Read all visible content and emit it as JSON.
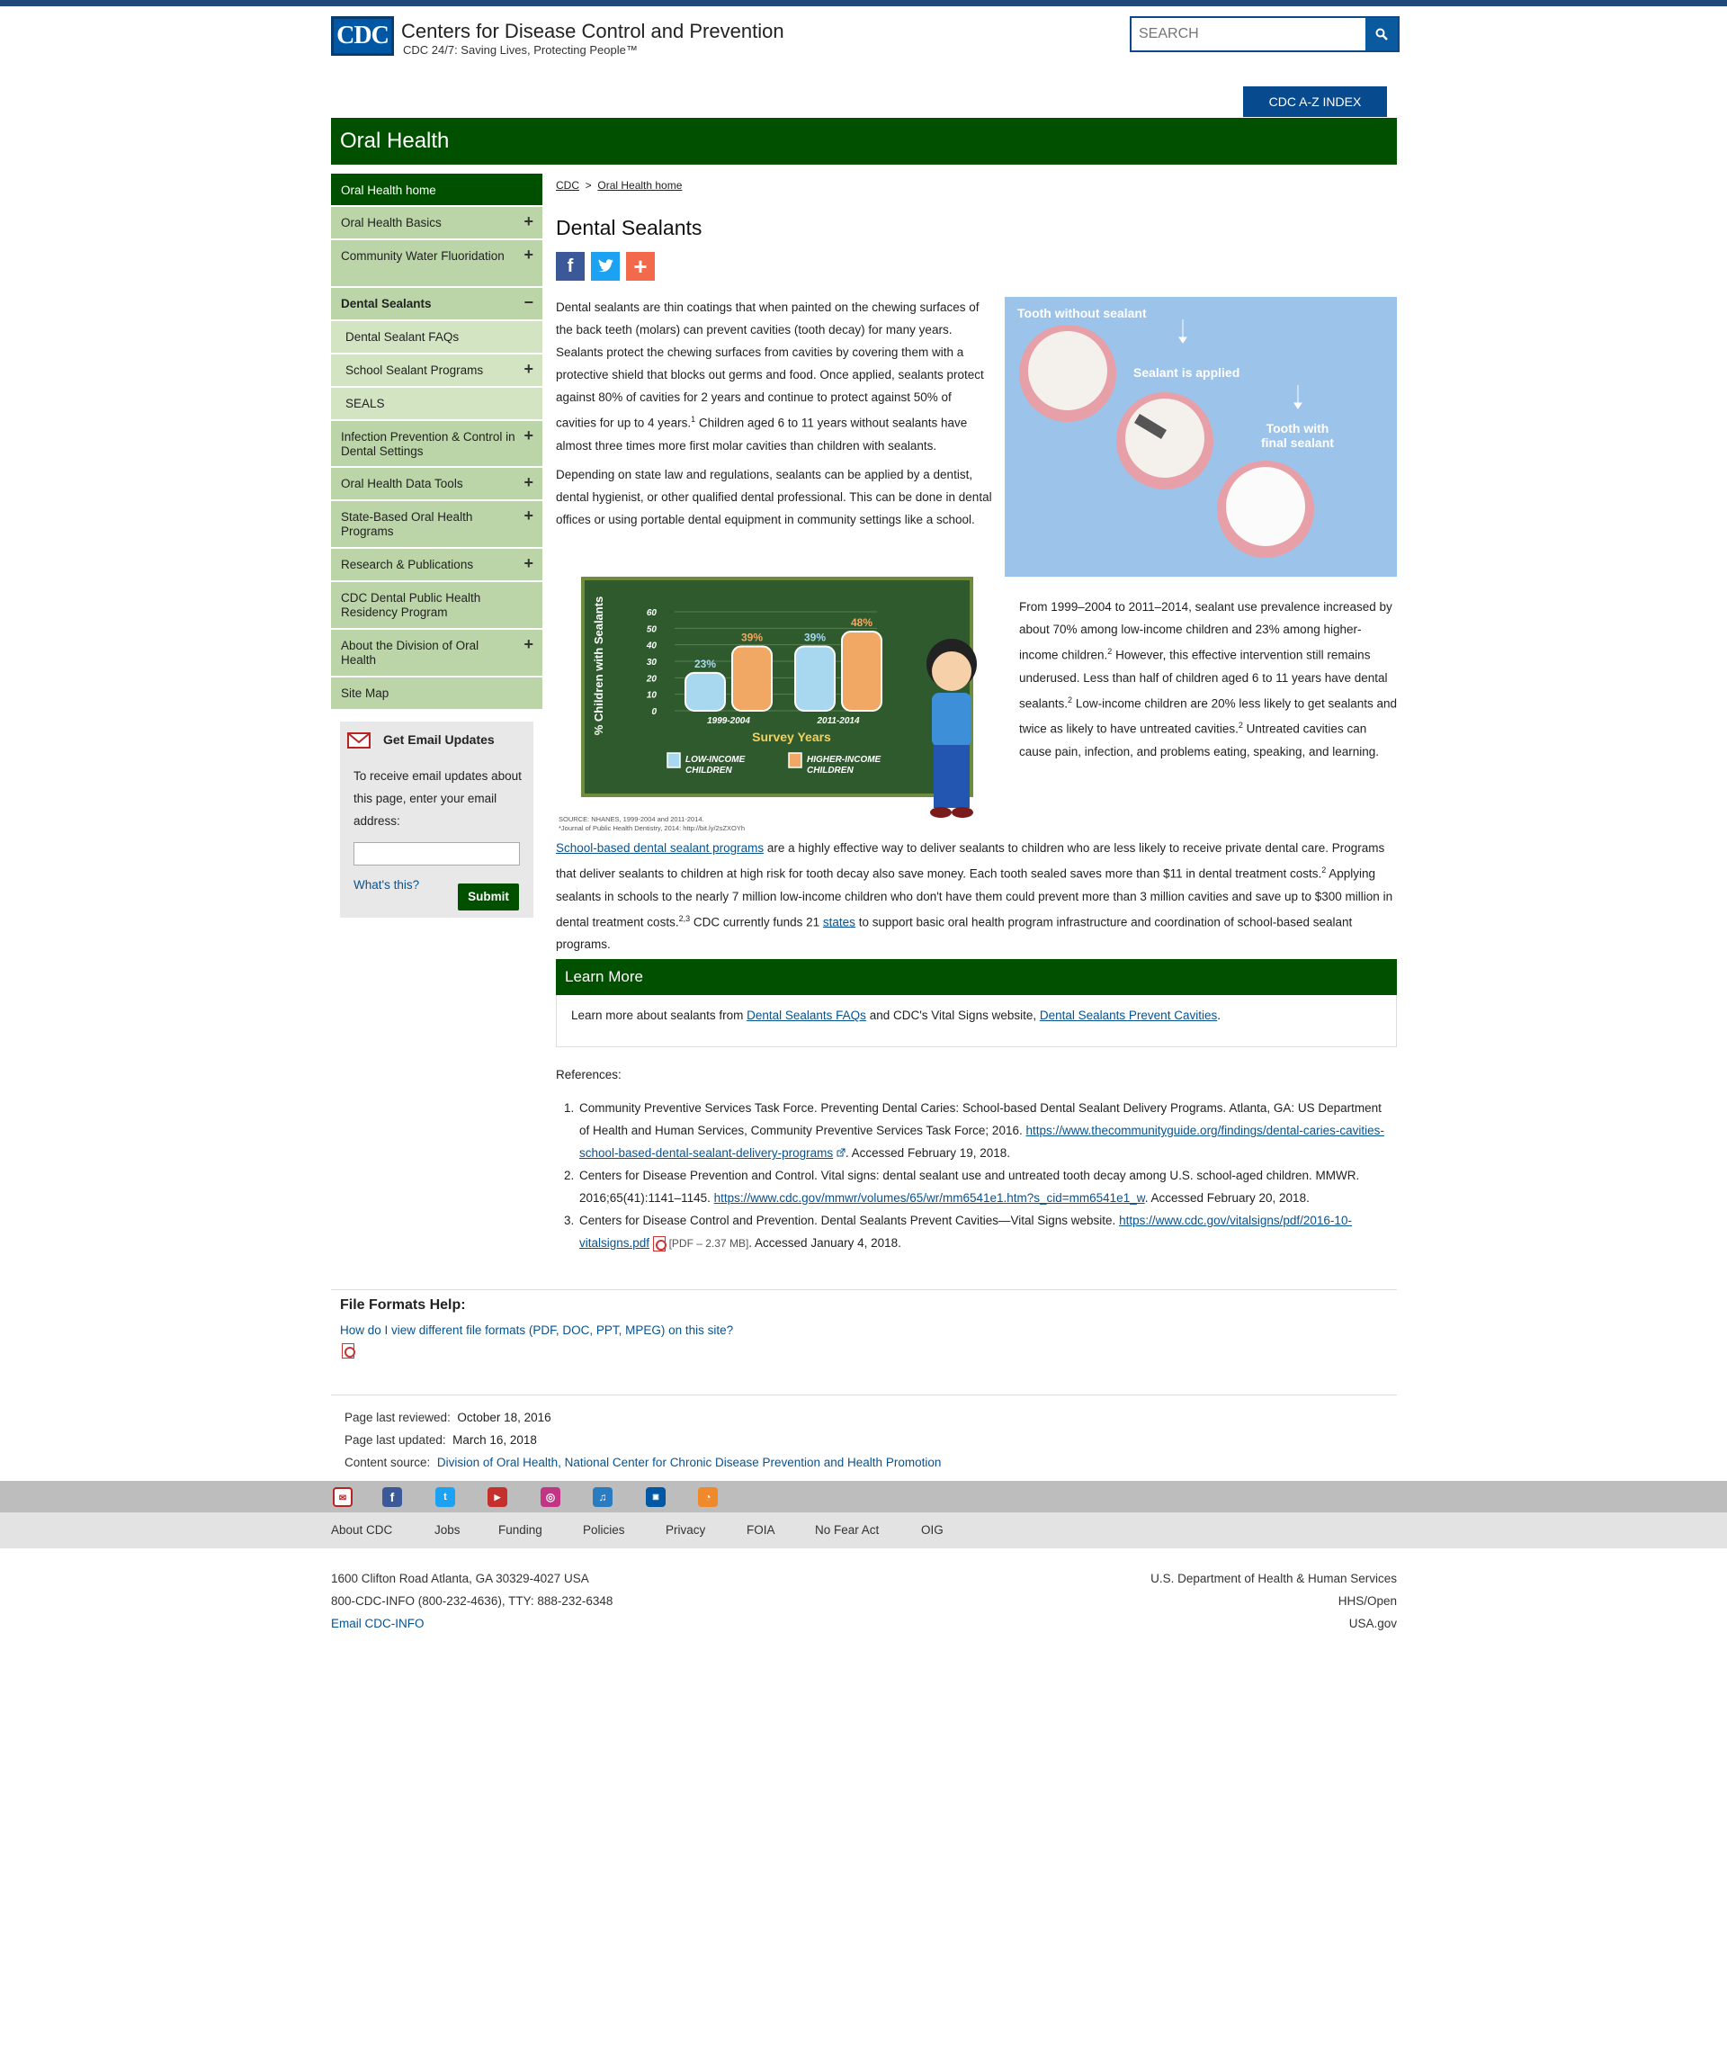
{
  "header": {
    "logo_text": "CDC",
    "title": "Centers for Disease Control and Prevention",
    "tagline": "CDC 24/7: Saving Lives, Protecting People™",
    "search_placeholder": "SEARCH",
    "az_index": "CDC A-Z INDEX",
    "section_title": "Oral Health"
  },
  "sidebar": {
    "items": [
      {
        "label": "Oral Health home"
      },
      {
        "label": "Oral Health Basics",
        "toggle": "+"
      },
      {
        "label": "Community Water Fluoridation",
        "toggle": "+"
      },
      {
        "label": "Dental Sealants",
        "toggle": "−"
      },
      {
        "label": "Dental Sealant FAQs"
      },
      {
        "label": "School Sealant Programs",
        "toggle": "+"
      },
      {
        "label": "SEALS"
      },
      {
        "label": "Infection Prevention & Control in Dental Settings",
        "toggle": "+"
      },
      {
        "label": "Oral Health Data Tools",
        "toggle": "+"
      },
      {
        "label": "State-Based Oral Health Programs",
        "toggle": "+"
      },
      {
        "label": "Research & Publications",
        "toggle": "+"
      },
      {
        "label": "CDC Dental Public Health Residency Program"
      },
      {
        "label": "About the Division of Oral Health",
        "toggle": "+"
      },
      {
        "label": "Site Map"
      }
    ],
    "email": {
      "title": "Get Email Updates",
      "text": "To receive email updates about this page, enter your email address:",
      "whats_this": "What's this?",
      "submit": "Submit"
    }
  },
  "breadcrumb": {
    "root": "CDC",
    "sep": ">",
    "current": "Oral Health home"
  },
  "page_title": "Dental Sealants",
  "intro": {
    "p1a": "Dental sealants are thin coatings that when painted on the chewing surfaces of the back teeth (molars) can prevent cavities (tooth decay) for many years. Sealants protect the chewing surfaces from cavities by covering them with a protective shield that blocks out germs and food. Once applied, sealants protect against 80% of cavities for 2 years and continue to protect against 50% of cavities for up to 4 years.",
    "p1_sup": "1",
    "p1b": " Children aged 6 to 11 years without sealants have almost three times more first molar cavities than children with sealants.",
    "p2": "Depending on state law and regulations, sealants can be applied by a dentist, dental hygienist, or other qualified dental professional. This can be done in dental offices or using portable dental equipment in community settings like a school."
  },
  "tooth_image": {
    "label1": "Tooth without sealant",
    "label2": "Sealant is applied",
    "label3a": "Tooth with",
    "label3b": "final sealant"
  },
  "chart_data": {
    "type": "bar",
    "ylabel": "% Children with Sealants",
    "xlabel": "Survey Years",
    "ylim": [
      0,
      60
    ],
    "yticks": [
      "60",
      "50",
      "40",
      "30",
      "20",
      "10",
      "0"
    ],
    "categories": [
      "1999-2004",
      "2011-2014"
    ],
    "series": [
      {
        "name": "LOW-INCOME CHILDREN",
        "values": [
          23,
          39
        ],
        "color": "#a8d8f0"
      },
      {
        "name": "HIGHER-INCOME CHILDREN",
        "values": [
          39,
          48
        ],
        "color": "#f2a865"
      }
    ],
    "data_labels": [
      "23%",
      "39%",
      "39%",
      "48%"
    ],
    "source_line1": "SOURCE: NHANES, 1999-2004 and 2011-2014.",
    "source_line2": "*Journal of Public Health Dentistry, 2014: http://bit.ly/2sZXOYh"
  },
  "right_para": {
    "a": "From 1999–2004 to 2011–2014, sealant use prevalence increased by about 70% among low-income children and 23% among higher-income children.",
    "s1": "2",
    "b": " However, this effective intervention still remains underused. Less than half of children aged 6 to 11 years have dental sealants.",
    "s2": "2",
    "c": " Low-income children are 20% less likely to get sealants and twice as likely to have untreated cavities.",
    "s3": "2",
    "d": " Untreated cavities can cause pain, infection, and problems eating, speaking, and learning."
  },
  "school_para": {
    "link": "School-based dental sealant programs",
    "a": " are a highly effective way to deliver sealants to children who are less likely to receive private dental care. Programs that deliver sealants to children at high risk for tooth decay also save money. Each tooth sealed saves more than $11 in dental treatment costs.",
    "s1": "2",
    "b": " Applying sealants in schools to the nearly 7 million low-income children who don't have them could prevent more than 3 million cavities and save up to $300 million in dental treatment costs.",
    "s2": "2,3",
    "c": " CDC currently funds 21 ",
    "states_link": "states",
    "d": " to support basic oral health program infrastructure and coordination of school-based sealant programs."
  },
  "learn_more": {
    "title": "Learn More",
    "a": "Learn more about sealants from ",
    "link1": "Dental Sealants FAQs",
    "b": " and CDC's Vital Signs website, ",
    "link2": "Dental Sealants Prevent Cavities",
    "c": "."
  },
  "references": {
    "title": "References:",
    "r1a": "Community Preventive Services Task Force. Preventing Dental Caries: School-based Dental Sealant Delivery Programs. Atlanta, GA: US Department of Health and Human Services, Community Preventive Services Task Force; 2016. ",
    "r1link": "https://www.thecommunityguide.org/findings/dental-caries-cavities-school-based-dental-sealant-delivery-programs",
    "r1b": ". Accessed February 19, 2018.",
    "r2a": "Centers for Disease Prevention and Control. Vital signs: dental sealant use and untreated tooth decay among U.S. school-aged children. MMWR. 2016;65(41):1141–1145. ",
    "r2link": "https://www.cdc.gov/mmwr/volumes/65/wr/mm6541e1.htm?s_cid=mm6541e1_w",
    "r2b": ". Accessed February 20, 2018.",
    "r3a": "Centers for Disease Control and Prevention. Dental Sealants Prevent Cavities—Vital Signs website. ",
    "r3link": "https://www.cdc.gov/vitalsigns/pdf/2016-10-vitalsigns.pdf",
    "r3pdf": "[PDF – 2.37 MB]",
    "r3b": ". Accessed January 4, 2018."
  },
  "file_formats": {
    "title": "File Formats Help:",
    "link": "How do I view different file formats (PDF, DOC, PPT, MPEG) on this site?"
  },
  "meta": {
    "reviewed_label": "Page last reviewed:",
    "reviewed": "October 18, 2016",
    "updated_label": "Page last updated:",
    "updated": "March 16, 2018",
    "source_label": "Content source:",
    "source": "Division of Oral Health, National Center for Chronic Disease Prevention and Health Promotion"
  },
  "footer": {
    "links": [
      "About CDC",
      "Jobs",
      "Funding",
      "Policies",
      "Privacy",
      "FOIA",
      "No Fear Act",
      "OIG"
    ],
    "address": "1600 Clifton Road Atlanta, GA 30329-4027 USA",
    "phone": "800-CDC-INFO (800-232-4636), TTY: 888-232-6348",
    "email": "Email CDC-INFO",
    "right1": "U.S. Department of Health & Human Services",
    "right2": "HHS/Open",
    "right3": "USA.gov"
  }
}
